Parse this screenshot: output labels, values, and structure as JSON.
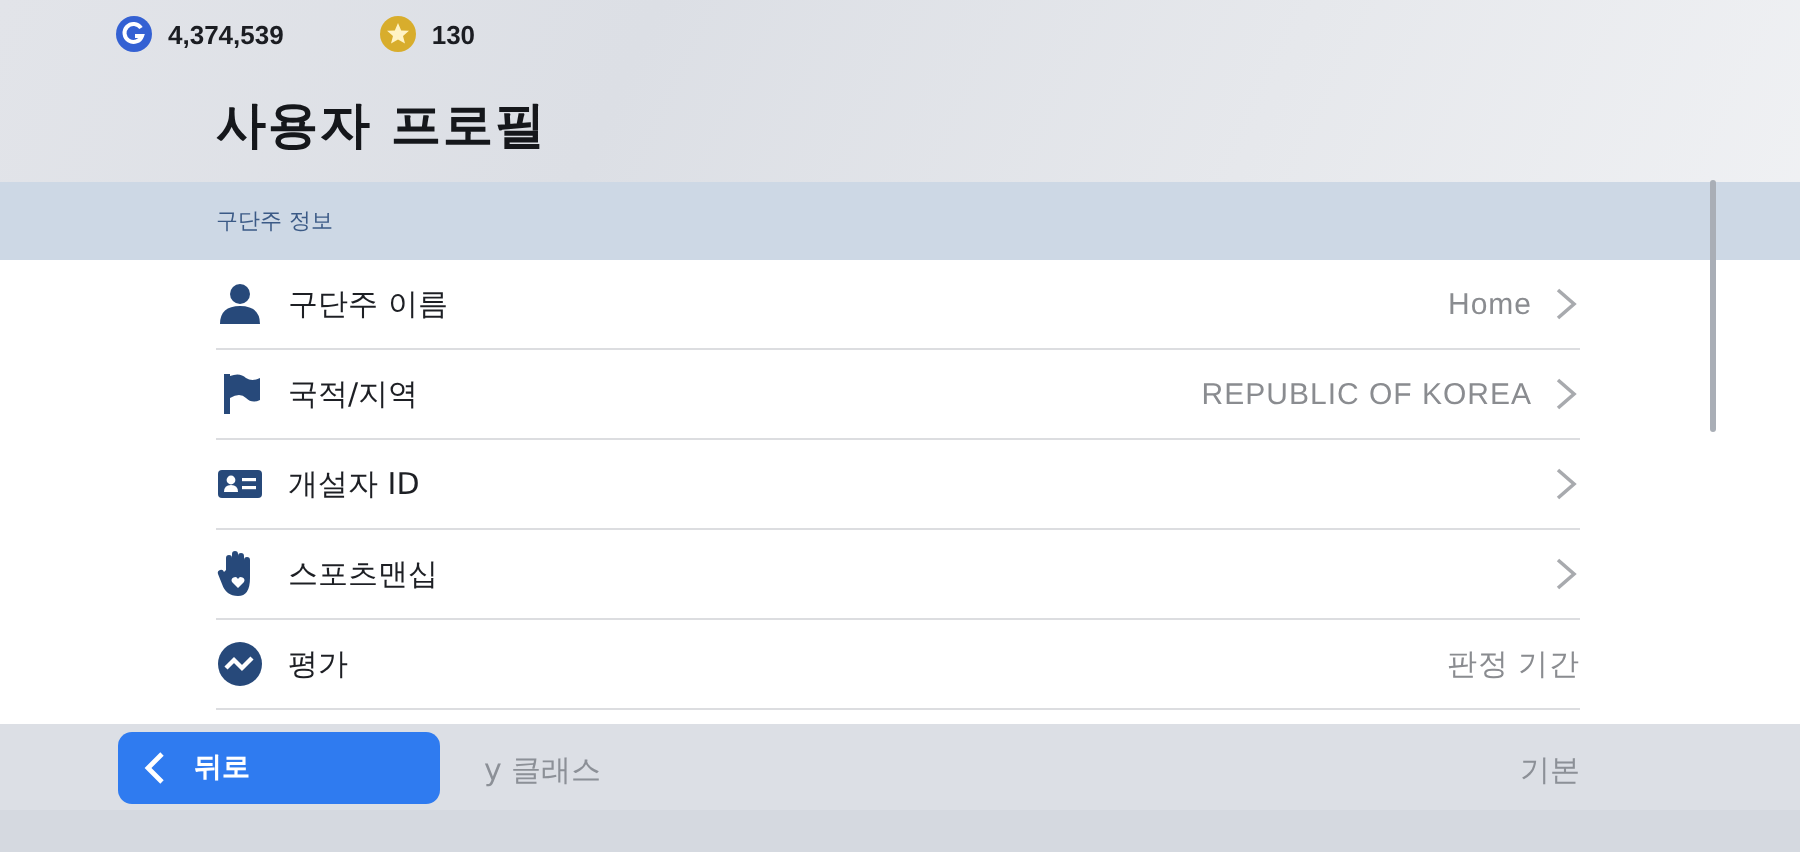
{
  "currencies": [
    {
      "kind": "gold",
      "amount": "4,374,539"
    },
    {
      "kind": "star",
      "amount": "130"
    }
  ],
  "title": "사용자 프로필",
  "section": {
    "heading": "구단주 정보",
    "rows": [
      {
        "kind": "person",
        "label": "구단주 이름",
        "value": "Home",
        "chevron": true
      },
      {
        "kind": "flag",
        "label": "국적/지역",
        "value": "REPUBLIC OF KOREA",
        "chevron": true
      },
      {
        "kind": "id",
        "label": "개설자 ID",
        "chevron": true
      },
      {
        "kind": "hand",
        "label": "스포츠맨십",
        "chevron": true
      },
      {
        "kind": "trend",
        "label": "평가",
        "value": "판정 기간",
        "chevron": false
      }
    ]
  },
  "bottom_bar": {
    "back_label": "뒤로",
    "row_label": "y 클래스",
    "row_value": "기본"
  }
}
